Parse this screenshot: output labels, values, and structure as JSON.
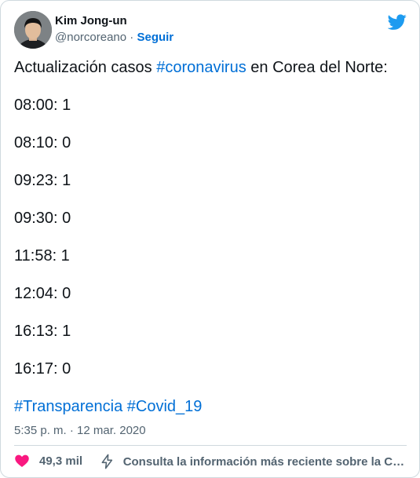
{
  "user": {
    "name": "Kim Jong-un",
    "handle": "@norcoreano",
    "separator": "·",
    "follow_label": "Seguir"
  },
  "tweet": {
    "intro_prefix": "Actualización casos ",
    "intro_hashtag": "#coronavirus",
    "intro_suffix": " en Corea del Norte:",
    "entries": [
      "08:00: 1",
      "08:10: 0",
      "09:23: 1",
      "09:30: 0",
      "11:58: 1",
      "12:04: 0",
      "16:13: 1",
      "16:17: 0"
    ],
    "hashtags": [
      "#Transparencia",
      "#Covid_19"
    ]
  },
  "meta": {
    "timestamp": "5:35 p. m. · 12 mar. 2020"
  },
  "actions": {
    "like_count": "49,3 mil",
    "info_text": "Consulta la información más reciente sobre la COVI…"
  },
  "colors": {
    "link": "#006fd6",
    "like": "#f91880",
    "twitter_brand": "#1d9bf0"
  },
  "icons": {
    "brand": "twitter-bird-icon",
    "like": "heart-icon",
    "info": "lightning-icon"
  }
}
